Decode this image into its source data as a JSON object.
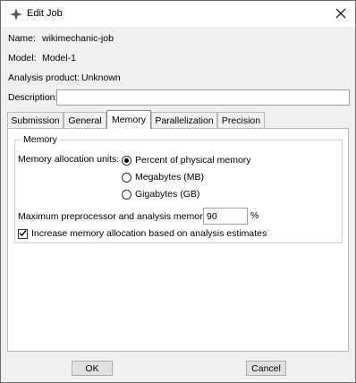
{
  "window": {
    "title": "Edit Job"
  },
  "job": {
    "name_label": "Name:",
    "name_value": "wikimechanic-job",
    "model_label": "Model:",
    "model_value": "Model-1",
    "analysis_product_label": "Analysis product:",
    "analysis_product_value": "Unknown",
    "description_label": "Description:",
    "description_value": ""
  },
  "tabs": [
    {
      "label": "Submission",
      "active": false
    },
    {
      "label": "General",
      "active": false
    },
    {
      "label": "Memory",
      "active": true
    },
    {
      "label": "Parallelization",
      "active": false
    },
    {
      "label": "Precision",
      "active": false
    }
  ],
  "memory": {
    "group_title": "Memory",
    "units_label": "Memory allocation units:",
    "options": [
      {
        "label": "Percent of physical memory",
        "selected": true
      },
      {
        "label": "Megabytes (MB)",
        "selected": false
      },
      {
        "label": "Gigabytes (GB)",
        "selected": false
      }
    ],
    "max_memory_label": "Maximum preprocessor and analysis memory:",
    "max_memory_value": "90",
    "max_memory_unit": "%",
    "increase_label": "Increase memory allocation based on analysis estimates",
    "increase_checked": true
  },
  "buttons": {
    "ok": "OK",
    "cancel": "Cancel"
  },
  "icons": {
    "app": "abaqus-star-icon",
    "close": "close-icon",
    "check": "checkmark-icon"
  }
}
